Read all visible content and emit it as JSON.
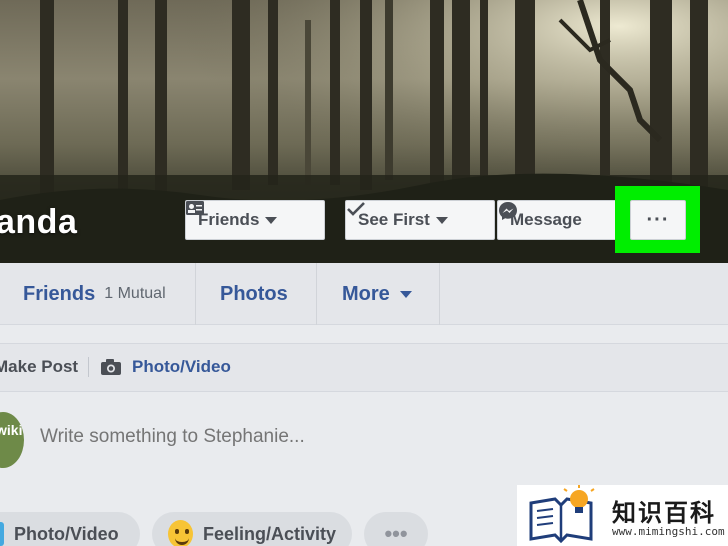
{
  "cover": {
    "profile_name": "anda",
    "buttons": {
      "friends": "Friends",
      "see_first": "See First",
      "message": "Message",
      "more": "···"
    }
  },
  "nav": {
    "friends_label": "Friends",
    "friends_mutual": "1 Mutual",
    "photos_label": "Photos",
    "more_label": "More"
  },
  "composer": {
    "make_post": "Make Post",
    "photo_video": "Photo/Video",
    "placeholder": "Write something to Stephanie...",
    "avatar_text": "wiki"
  },
  "actions": {
    "photo_video": "Photo/Video",
    "feeling_activity": "Feeling/Activity",
    "more": "•••"
  },
  "watermark": {
    "title": "知识百科",
    "url": "www.mimingshi.com"
  },
  "colors": {
    "highlight": "#00ee00",
    "link_blue": "#365899",
    "background": "#e9ebee"
  }
}
